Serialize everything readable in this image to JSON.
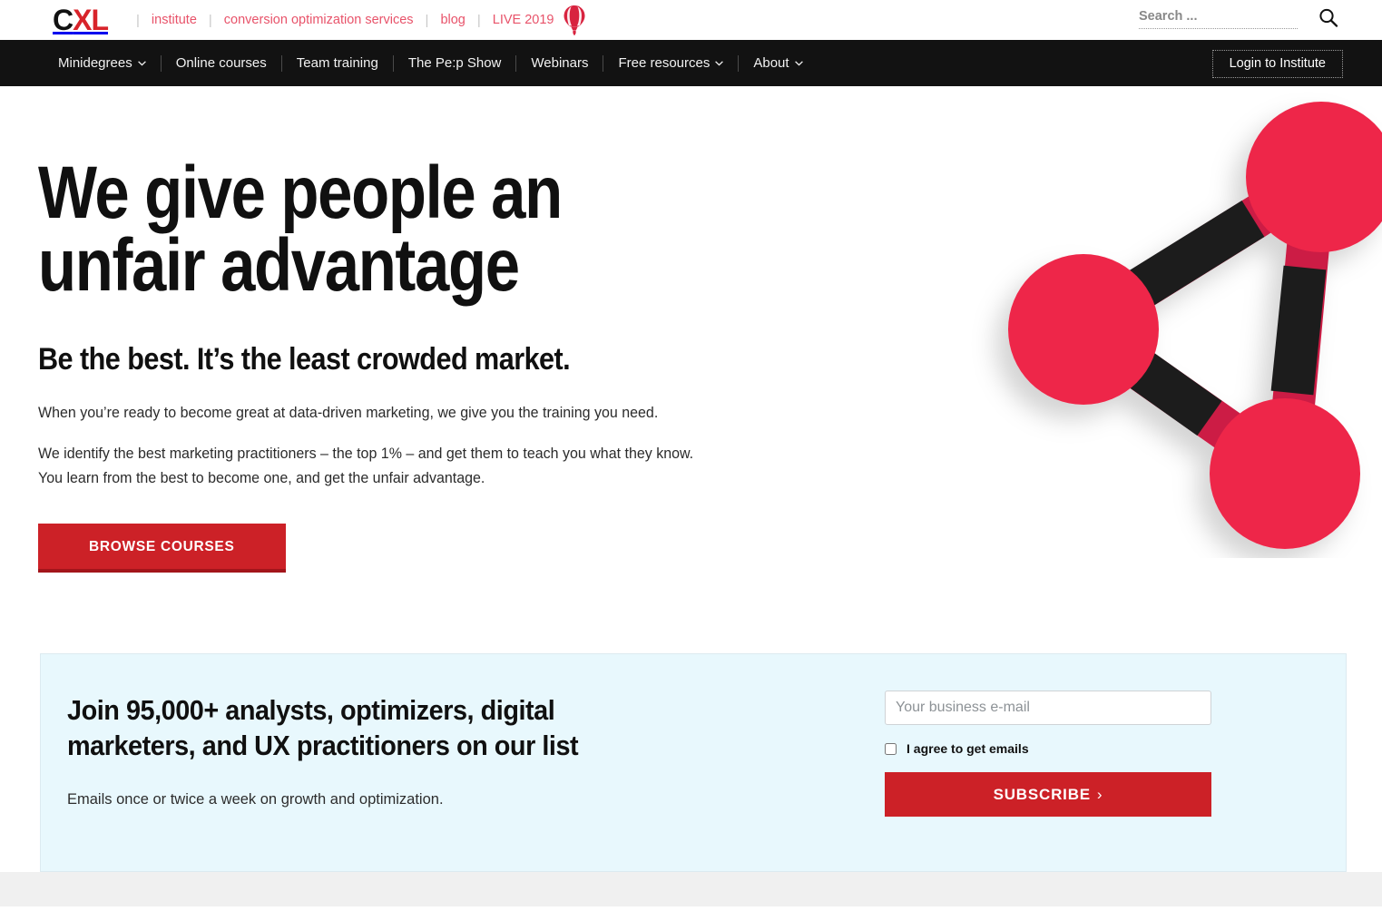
{
  "brand": {
    "logo_c": "C",
    "logo_xl": "XL",
    "accent_red": "#cc2127",
    "link_red": "#e8536a",
    "node_red": "#ee2749",
    "node_red_dark": "#cc1d44",
    "nav_black": "#121212",
    "newsletter_bg": "#e8f8fd",
    "footer_gray": "#f0f0f0"
  },
  "topbar": {
    "links": [
      {
        "label": "institute"
      },
      {
        "label": "conversion optimization services"
      },
      {
        "label": "blog"
      },
      {
        "label": "LIVE 2019"
      }
    ],
    "balloon_icon": "hot-air-balloon-icon",
    "search": {
      "placeholder": "Search ...",
      "value": "",
      "icon": "search-icon"
    }
  },
  "nav": {
    "items": [
      {
        "label": "Minidegrees",
        "has_dropdown": true
      },
      {
        "label": "Online courses",
        "has_dropdown": false
      },
      {
        "label": "Team training",
        "has_dropdown": false
      },
      {
        "label": "The Pe:p Show",
        "has_dropdown": false
      },
      {
        "label": "Webinars",
        "has_dropdown": false
      },
      {
        "label": "Free resources",
        "has_dropdown": true
      },
      {
        "label": "About",
        "has_dropdown": true
      }
    ],
    "chevron": "⌄",
    "login_label": "Login to Institute"
  },
  "hero": {
    "headline": "We give people an\nunfair advantage",
    "subheadline": "Be the best. It’s the least crowded market.",
    "paragraph1": "When you’re ready to become great at data-driven marketing, we give you the training you need.",
    "paragraph2": "We identify the best marketing practitioners – the top 1% – and get them to teach you what they know. You learn from the best to become one, and get the unfair advantage.",
    "cta_label": "BROWSE COURSES",
    "graphic_name": "molecule-network-graphic"
  },
  "newsletter": {
    "title": "Join 95,000+ analysts, optimizers, digital\nmarketers, and UX practitioners on our list",
    "subtitle": "Emails once or twice a week on growth and optimization.",
    "email_placeholder": "Your business e-mail",
    "email_value": "",
    "agree_label": "I agree to get emails",
    "agree_checked": false,
    "subscribe_label": "SUBSCRIBE",
    "subscribe_arrow": "›"
  }
}
